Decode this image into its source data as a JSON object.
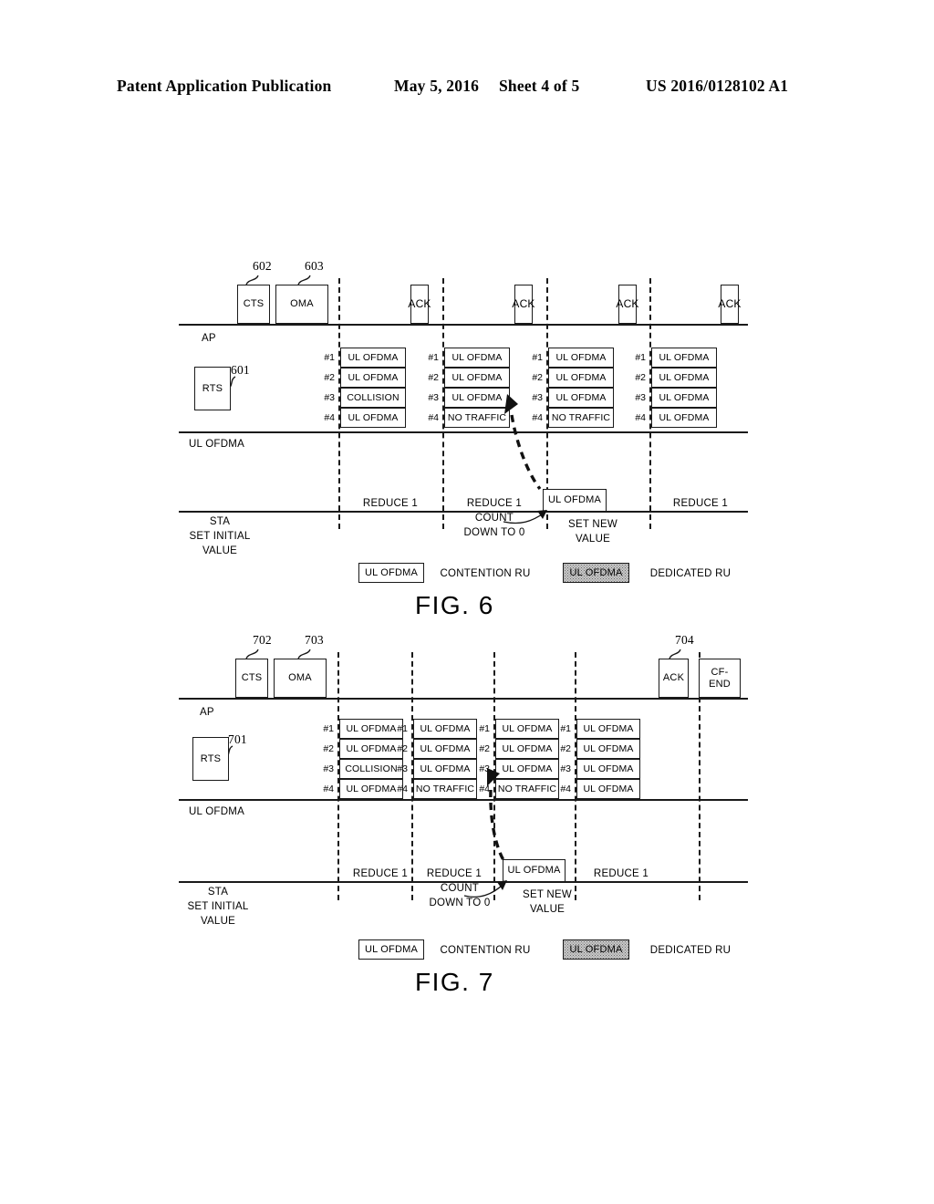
{
  "header": {
    "publication": "Patent Application Publication",
    "date": "May 5, 2016",
    "sheet": "Sheet 4 of 5",
    "patent_number": "US 2016/0128102 A1"
  },
  "legend": {
    "contention_box": "UL OFDMA",
    "contention_label": "CONTENTION RU",
    "dedicated_box": "UL OFDMA",
    "dedicated_label": "DEDICATED RU"
  },
  "labels": {
    "ap": "AP",
    "sta": "STA",
    "ul_ofdma_axis": "UL OFDMA",
    "set_initial_value": "SET INITIAL\nVALUE",
    "reduce": "REDUCE 1",
    "count_down": "COUNT\nDOWN TO 0",
    "set_new_value": "SET NEW\nVALUE",
    "ul_ofdma_box": "UL OFDMA",
    "ack_vertical": "A\nC\nK",
    "ru_index": [
      "#1",
      "#2",
      "#3",
      "#4"
    ]
  },
  "fig6": {
    "caption": "FIG. 6",
    "rts": {
      "label": "RTS",
      "ref": "601"
    },
    "cts": {
      "label": "CTS",
      "ref": "602"
    },
    "oma": {
      "label": "OMA",
      "ref": "603"
    },
    "acks": [
      "ACK",
      "ACK",
      "ACK",
      "ACK"
    ],
    "ru_groups": [
      {
        "rows": [
          "UL OFDMA",
          "UL OFDMA",
          "COLLISION",
          "UL OFDMA"
        ],
        "styles": [
          "shaded",
          "plain",
          "hatch",
          "plain"
        ]
      },
      {
        "rows": [
          "UL OFDMA",
          "UL OFDMA",
          "UL OFDMA",
          "NO TRAFFIC"
        ],
        "styles": [
          "shaded",
          "plain",
          "plain",
          "plain"
        ]
      },
      {
        "rows": [
          "UL OFDMA",
          "UL OFDMA",
          "UL OFDMA",
          "NO TRAFFIC"
        ],
        "styles": [
          "plain",
          "plain",
          "plain",
          "plain"
        ]
      },
      {
        "rows": [
          "UL OFDMA",
          "UL OFDMA",
          "UL OFDMA",
          "UL OFDMA"
        ],
        "styles": [
          "plain",
          "plain",
          "plain",
          "plain"
        ]
      }
    ],
    "sta_annotations": [
      "REDUCE 1",
      "REDUCE 1",
      "REDUCE 1"
    ]
  },
  "fig7": {
    "caption": "FIG. 7",
    "rts": {
      "label": "RTS",
      "ref": "701"
    },
    "cts": {
      "label": "CTS",
      "ref": "702"
    },
    "oma": {
      "label": "OMA",
      "ref": "703"
    },
    "ack": {
      "label": "ACK",
      "ref": "704"
    },
    "cf_end": {
      "label": "CF-\nEND"
    },
    "ru_groups": [
      {
        "rows": [
          "UL OFDMA",
          "UL OFDMA",
          "COLLISION",
          "UL OFDMA"
        ],
        "styles": [
          "shaded",
          "plain",
          "hatch",
          "plain"
        ]
      },
      {
        "rows": [
          "UL OFDMA",
          "UL OFDMA",
          "UL OFDMA",
          "NO TRAFFIC"
        ],
        "styles": [
          "shaded",
          "plain",
          "plain",
          "plain"
        ]
      },
      {
        "rows": [
          "UL OFDMA",
          "UL OFDMA",
          "UL OFDMA",
          "NO TRAFFIC"
        ],
        "styles": [
          "plain",
          "plain",
          "plain",
          "plain"
        ]
      },
      {
        "rows": [
          "UL OFDMA",
          "UL OFDMA",
          "UL OFDMA",
          "UL OFDMA"
        ],
        "styles": [
          "plain",
          "plain",
          "plain",
          "plain"
        ]
      }
    ],
    "sta_annotations": [
      "REDUCE 1",
      "REDUCE 1",
      "REDUCE 1"
    ]
  }
}
